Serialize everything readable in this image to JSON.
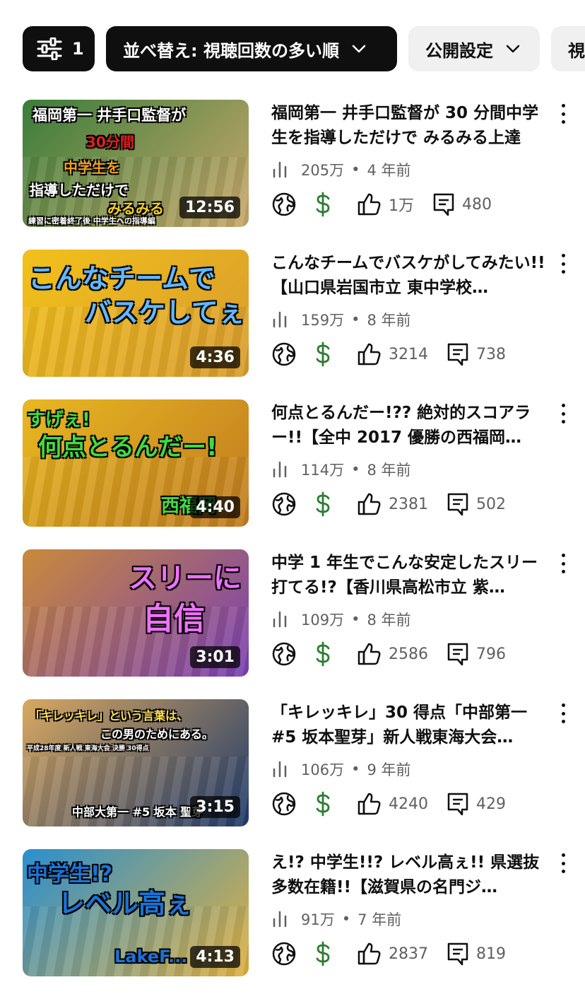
{
  "filters": {
    "filter_count": "1",
    "sort_label": "並べ替え: 視聴回数の多い順",
    "visibility_label": "公開設定",
    "partial_chip_label": "視"
  },
  "videos": [
    {
      "title": "福岡第一 井手口監督が 30 分間中学生を指導しただけで みるみる上達",
      "views": "205万",
      "age": "4 年前",
      "likes": "1万",
      "comments": "480",
      "duration": "12:56",
      "thumb_text": [
        "福岡第一 井手口監督が",
        "30分間",
        "中学生を",
        "指導しただけで",
        "みるみる",
        "練習に密着終了後 中学生への指導編"
      ],
      "thumb_colors": [
        "#3a7d3a",
        "#c9a86b"
      ]
    },
    {
      "title": "こんなチームでバスケがしてみたい!! 【山口県岩国市立 東中学校…",
      "views": "159万",
      "age": "8 年前",
      "likes": "3214",
      "comments": "738",
      "duration": "4:36",
      "thumb_text": [
        "こんなチームで",
        "バスケしてぇ"
      ],
      "thumb_colors": [
        "#f2c11a",
        "#d89b2e"
      ]
    },
    {
      "title": "何点とるんだー!?? 絶対的スコアラー!!【全中 2017 優勝の西福岡…",
      "views": "114万",
      "age": "8 年前",
      "likes": "2381",
      "comments": "502",
      "duration": "4:40",
      "thumb_text": [
        "すげぇ!",
        "何点とるんだー!",
        "西福岡"
      ],
      "thumb_colors": [
        "#e8b820",
        "#c07a20"
      ]
    },
    {
      "title": "中学 1 年生でこんな安定したスリー打てる!?【香川県高松市立 紫…",
      "views": "109万",
      "age": "8 年前",
      "likes": "2586",
      "comments": "796",
      "duration": "3:01",
      "thumb_text": [
        "スリーに",
        "自信"
      ],
      "thumb_colors": [
        "#c98a3a",
        "#7a3fb3"
      ]
    },
    {
      "title": "「キレッキレ」30 得点「中部第一 #5 坂本聖芽」新人戦東海大会…",
      "views": "106万",
      "age": "9 年前",
      "likes": "4240",
      "comments": "429",
      "duration": "3:15",
      "thumb_text": [
        "「キレッキレ」という言葉は、",
        "この男のためにある。",
        "中部大第一 #5 坂本 聖芽",
        "平成28年度 新人戦 東海大会 決勝 30得点"
      ],
      "thumb_colors": [
        "#d9a860",
        "#1f3a6b"
      ]
    },
    {
      "title": "え!? 中学生!!? レベル高ぇ!! 県選抜多数在籍!!【滋賀県の名門ジ…",
      "views": "91万",
      "age": "7 年前",
      "likes": "2837",
      "comments": "819",
      "duration": "4:13",
      "thumb_text": [
        "中学生!?",
        "レベル高ぇ",
        "LakeF..."
      ],
      "thumb_colors": [
        "#2a8fd0",
        "#e0b040"
      ]
    }
  ],
  "colors": {
    "dollar": "#2e7d32",
    "text_secondary": "#606060",
    "chip_dark": "#0f0f0f",
    "chip_light": "#f0f0f0"
  }
}
